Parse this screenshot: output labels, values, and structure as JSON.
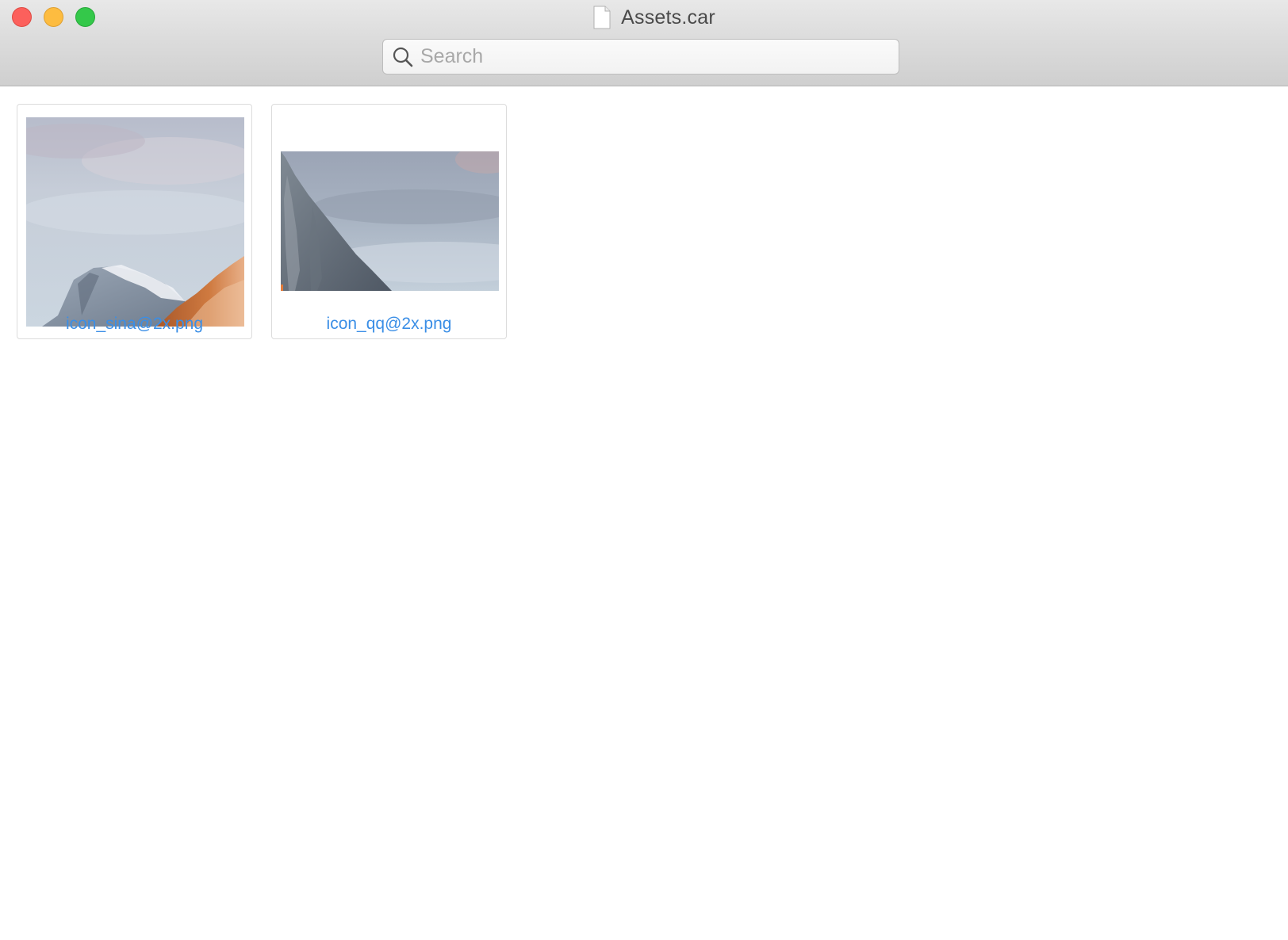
{
  "window": {
    "title": "Assets.car",
    "title_icon": "document-icon",
    "controls": [
      "close",
      "minimize",
      "zoom"
    ]
  },
  "search": {
    "placeholder": "Search",
    "value": "",
    "icon": "search-icon"
  },
  "assets": [
    {
      "name": "icon_sina@2x.png"
    },
    {
      "name": "icon_qq@2x.png"
    }
  ],
  "colors": {
    "label": "#3a8ee6",
    "close": "#fc605c",
    "minimize": "#fdbc40",
    "zoom": "#34c84a"
  }
}
